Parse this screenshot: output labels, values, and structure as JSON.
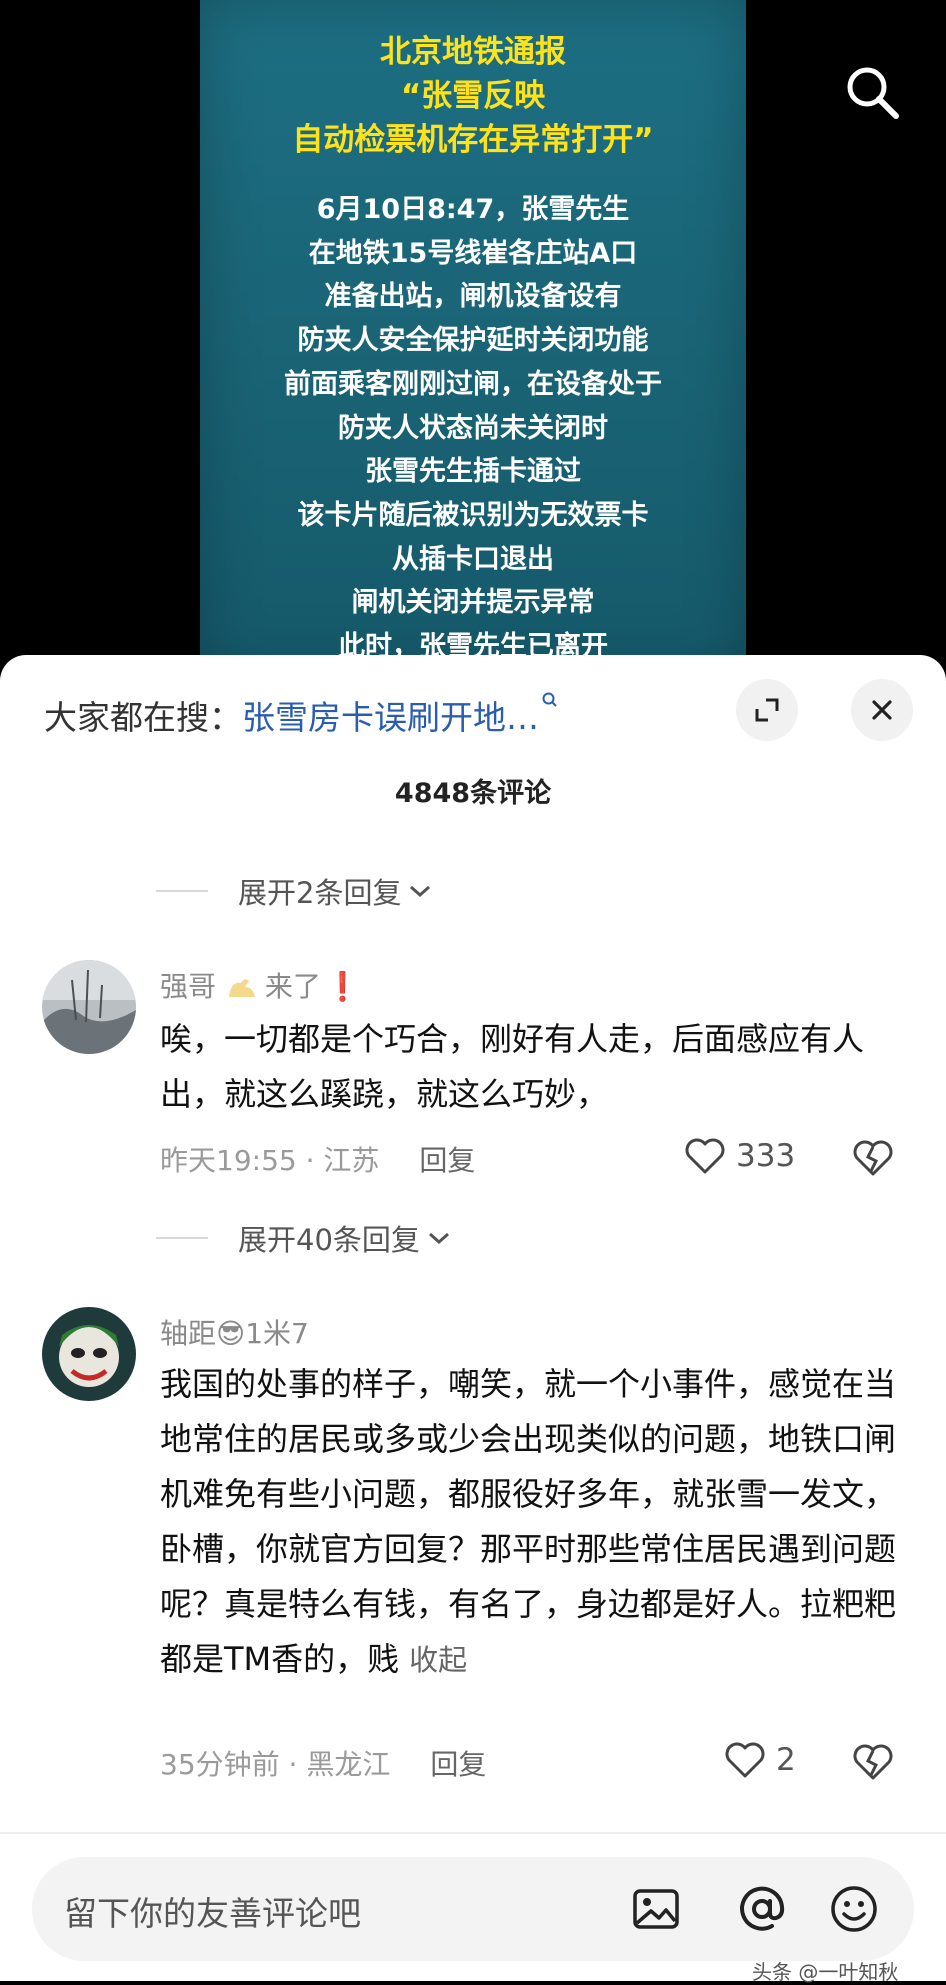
{
  "video": {
    "title_lines": [
      "北京地铁通报",
      "“张雪反映",
      "自动检票机存在异常打开”"
    ],
    "body_lines": [
      "6月10日8:47，张雪先生",
      "在地铁15号线崔各庄站A口",
      "准备出站，闸机设备设有",
      "防夹人安全保护延时关闭功能",
      "前面乘客刚刚过闸，在设备处于",
      "防夹人状态尚未关闭时",
      "张雪先生插卡通过",
      "该卡片随后被识别为无效票卡",
      "从插卡口退出",
      "闸机关闭并提示异常",
      "此时，张雪先生已离开"
    ],
    "colors": {
      "title": "#ffe21a",
      "background": "#1a6577"
    }
  },
  "sheet": {
    "hot_search_label": "大家都在搜：",
    "hot_search_term": "张雪房卡误刷开地…",
    "comment_count": "4848条评论"
  },
  "comments": [
    {
      "expand_label": "展开2条回复",
      "username": "强哥",
      "username_suffix": "来了",
      "text": "唉，一切都是个巧合，刚好有人走，后面感应有人出，就这么蹊跷，就这么巧妙，",
      "time": "昨天19:55",
      "location": "江苏",
      "reply_label": "回复",
      "likes": "333"
    },
    {
      "expand_label": "展开40条回复",
      "username": "轴距",
      "username_suffix": "1米7",
      "text": "我国的处事的样子，嘲笑，就一个小事件，感觉在当地常住的居民或多或少会出现类似的问题，地铁口闸机难免有些小问题，都服役好多年，就张雪一发文，卧槽，你就官方回复？那平时那些常住居民遇到问题呢？真是特么有钱，有名了，身边都是好人。拉粑粑都是TM香的，贱",
      "collapse_label": "收起",
      "time": "35分钟前",
      "location": "黑龙江",
      "reply_label": "回复",
      "likes": "2"
    }
  ],
  "input": {
    "placeholder": "留下你的友善评论吧"
  },
  "watermark": "头条 @一叶知秋",
  "icons": [
    "search-icon",
    "expand-icon",
    "close-icon",
    "chevron-down-icon",
    "heart-icon",
    "broken-heart-icon",
    "image-icon",
    "at-icon",
    "emoji-icon"
  ]
}
